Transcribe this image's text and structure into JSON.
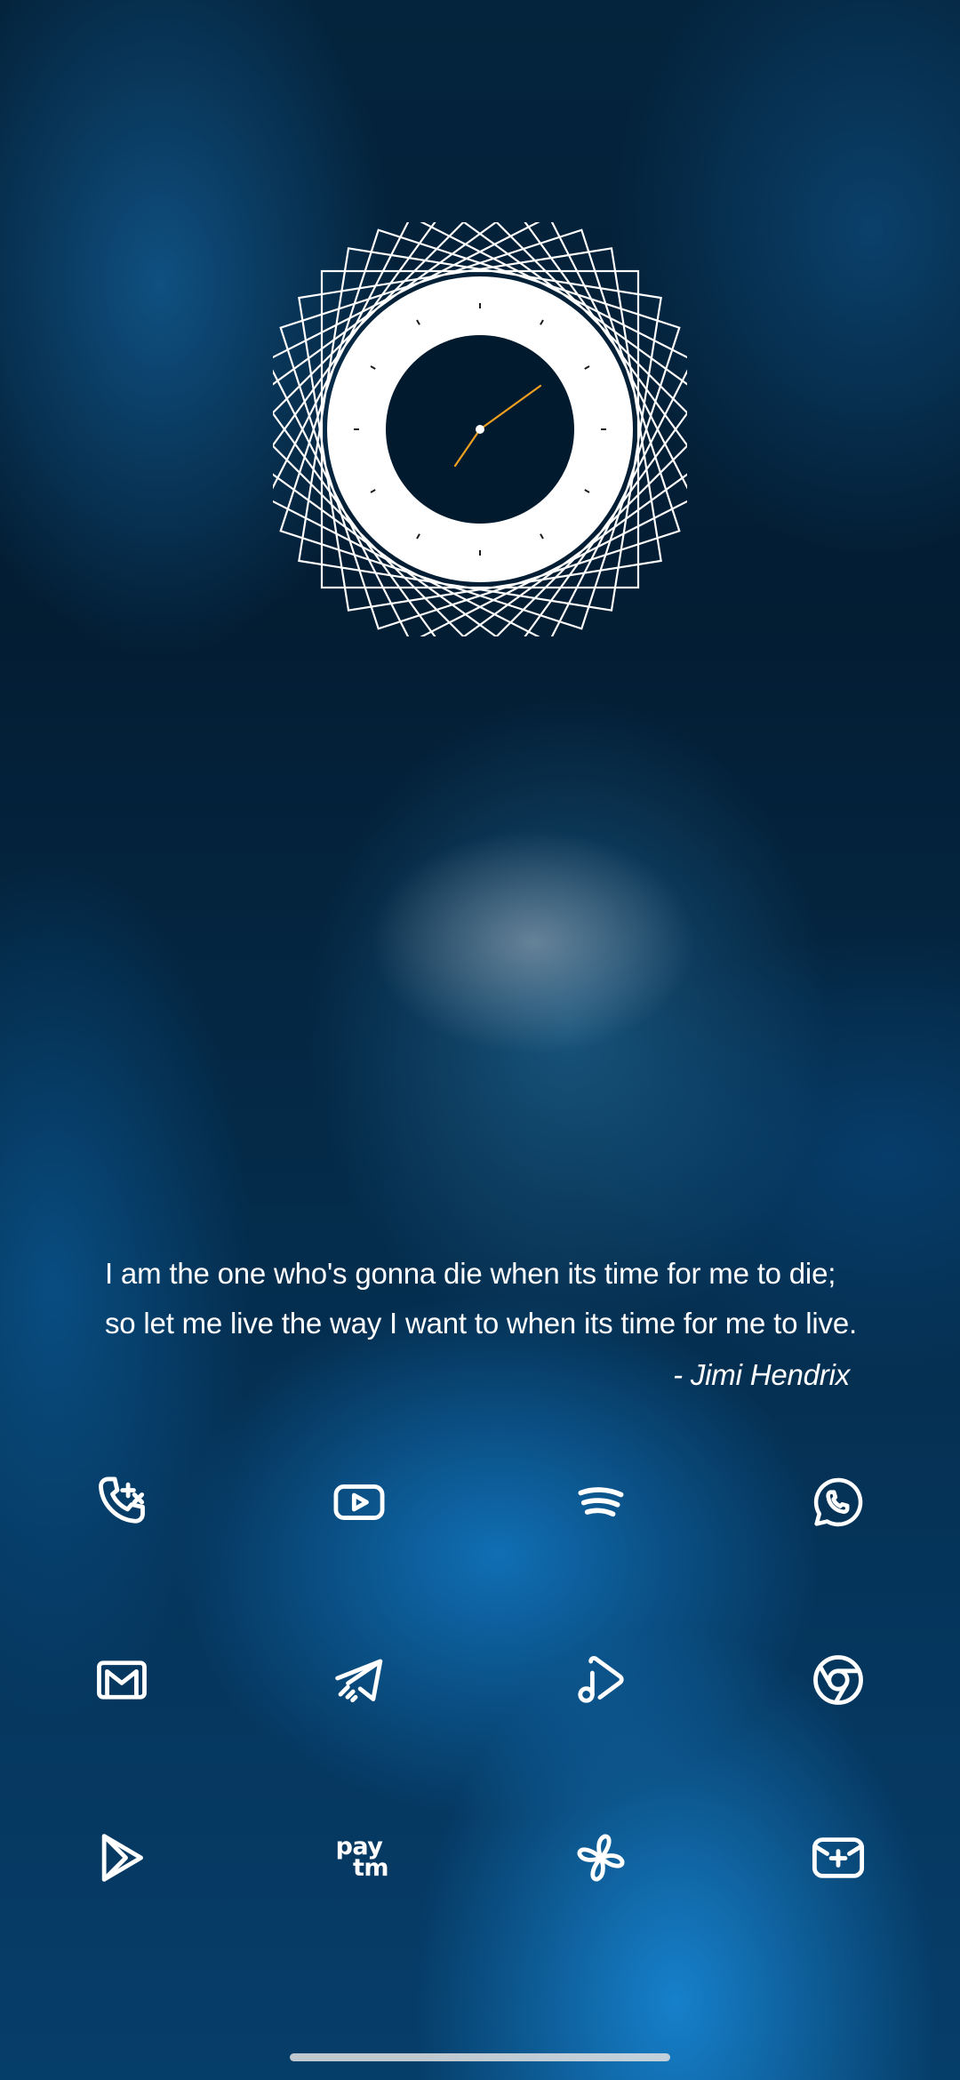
{
  "quote": {
    "line1": "I am the one who's gonna die when its time for me to die;",
    "line2": "so let me live the way I want to when its time for me to live.",
    "author": "- Jimi Hendrix"
  },
  "clock": {
    "style": "spirograph-analog",
    "hands_color": "#f0a020"
  },
  "apps": [
    {
      "name": "phone",
      "icon": "phone-icon"
    },
    {
      "name": "youtube",
      "icon": "youtube-icon"
    },
    {
      "name": "spotify",
      "icon": "spotify-icon"
    },
    {
      "name": "whatsapp",
      "icon": "whatsapp-icon"
    },
    {
      "name": "gmail",
      "icon": "gmail-icon"
    },
    {
      "name": "telegram",
      "icon": "telegram-icon"
    },
    {
      "name": "youtube-music",
      "icon": "youtube-music-icon"
    },
    {
      "name": "chrome",
      "icon": "chrome-icon"
    },
    {
      "name": "play-store",
      "icon": "play-store-icon"
    },
    {
      "name": "paytm",
      "icon": "paytm-icon",
      "label_top": "pay",
      "label_bottom": "tm"
    },
    {
      "name": "pinwheel",
      "icon": "pinwheel-icon"
    },
    {
      "name": "new-mail",
      "icon": "new-mail-icon"
    }
  ],
  "colors": {
    "background_dark": "#031d33",
    "background_accent": "#1b8ad6",
    "foreground": "#ffffff"
  }
}
